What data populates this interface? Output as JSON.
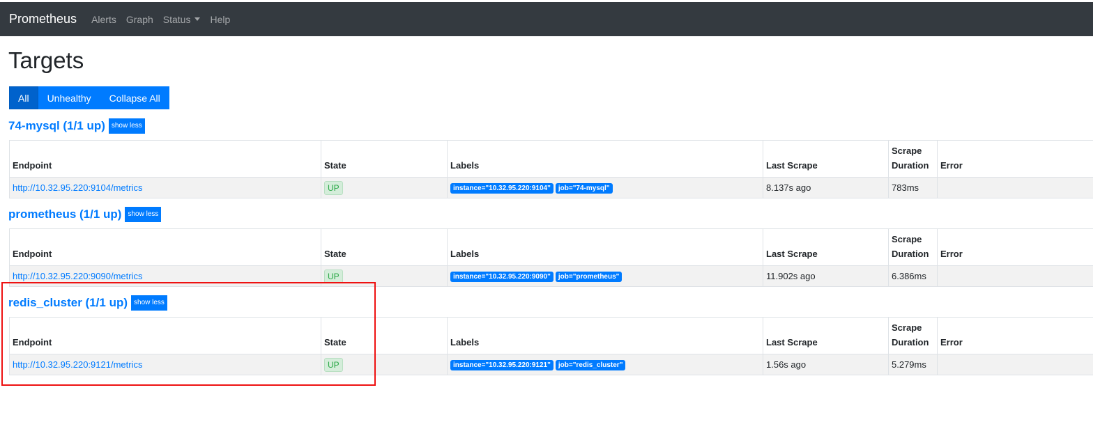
{
  "nav": {
    "brand": "Prometheus",
    "links": [
      "Alerts",
      "Graph",
      "Status",
      "Help"
    ]
  },
  "page": {
    "title": "Targets",
    "filters": [
      "All",
      "Unhealthy",
      "Collapse All"
    ],
    "active_filter": "All"
  },
  "columns": {
    "endpoint": "Endpoint",
    "state": "State",
    "labels": "Labels",
    "last_scrape": "Last Scrape",
    "scrape_duration": "Scrape Duration",
    "error": "Error"
  },
  "sections": [
    {
      "title": "74-mysql (1/1 up)",
      "toggle": "show less",
      "endpoint": "http://10.32.95.220:9104/metrics",
      "state": "UP",
      "labels": [
        "instance=\"10.32.95.220:9104\"",
        "job=\"74-mysql\""
      ],
      "last_scrape": "8.137s ago",
      "scrape_duration": "783ms",
      "error": ""
    },
    {
      "title": "prometheus (1/1 up)",
      "toggle": "show less",
      "endpoint": "http://10.32.95.220:9090/metrics",
      "state": "UP",
      "labels": [
        "instance=\"10.32.95.220:9090\"",
        "job=\"prometheus\""
      ],
      "last_scrape": "11.902s ago",
      "scrape_duration": "6.386ms",
      "error": ""
    },
    {
      "title": "redis_cluster (1/1 up)",
      "toggle": "show less",
      "endpoint": "http://10.32.95.220:9121/metrics",
      "state": "UP",
      "labels": [
        "instance=\"10.32.95.220:9121\"",
        "job=\"redis_cluster\""
      ],
      "last_scrape": "1.56s ago",
      "scrape_duration": "5.279ms",
      "error": ""
    }
  ],
  "colors": {
    "navbar": "#343a40",
    "primary": "#007bff",
    "up_badge": "#d4edda",
    "highlight": "#ee1111"
  }
}
